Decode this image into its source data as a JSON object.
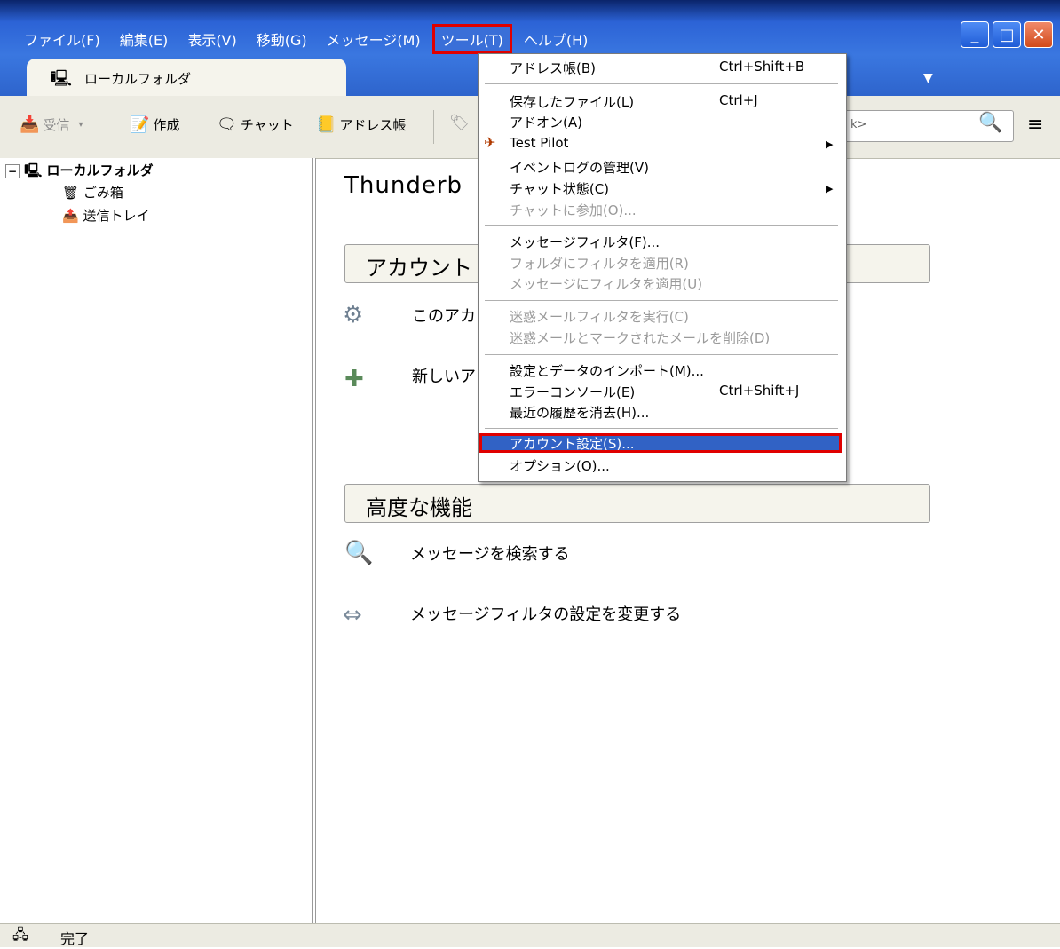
{
  "menubar": {
    "items": [
      "ファイル(F)",
      "編集(E)",
      "表示(V)",
      "移動(G)",
      "メッセージ(M)",
      "ツール(T)",
      "ヘルプ(H)"
    ]
  },
  "tab": {
    "label": "ローカルフォルダ"
  },
  "toolbar": {
    "get_mail": "受信",
    "write": "作成",
    "chat": "チャット",
    "address_book": "アドレス帳",
    "search_placeholder": "k>"
  },
  "folders": {
    "root": "ローカルフォルダ",
    "trash": "ごみ箱",
    "outbox": "送信トレイ"
  },
  "main": {
    "title": "Thunderb",
    "section_accounts": "アカウント",
    "account_row1": "このアカ",
    "account_row2": "新しいア",
    "section_advanced": "高度な機能",
    "adv_search": "メッセージを検索する",
    "adv_filters": "メッセージフィルタの設定を変更する"
  },
  "tools_menu": {
    "address_book": "アドレス帳(B)",
    "address_book_sc": "Ctrl+Shift+B",
    "saved_files": "保存したファイル(L)",
    "saved_files_sc": "Ctrl+J",
    "addons": "アドオン(A)",
    "test_pilot": "Test Pilot",
    "activity": "イベントログの管理(V)",
    "chat_status": "チャット状態(C)",
    "join_chat": "チャットに参加(O)...",
    "message_filters": "メッセージフィルタ(F)...",
    "apply_folder_filters": "フォルダにフィルタを適用(R)",
    "apply_message_filters": "メッセージにフィルタを適用(U)",
    "run_junk": "迷惑メールフィルタを実行(C)",
    "delete_junk": "迷惑メールとマークされたメールを削除(D)",
    "import": "設定とデータのインポート(M)...",
    "error_console": "エラーコンソール(E)",
    "error_console_sc": "Ctrl+Shift+J",
    "clear_history": "最近の履歴を消去(H)...",
    "account_settings": "アカウント設定(S)...",
    "options": "オプション(O)..."
  },
  "status": {
    "text": "完了"
  },
  "colors": {
    "titlebar": "#2c63d6",
    "highlight": "#3162c5",
    "annotation": "#e00000"
  }
}
